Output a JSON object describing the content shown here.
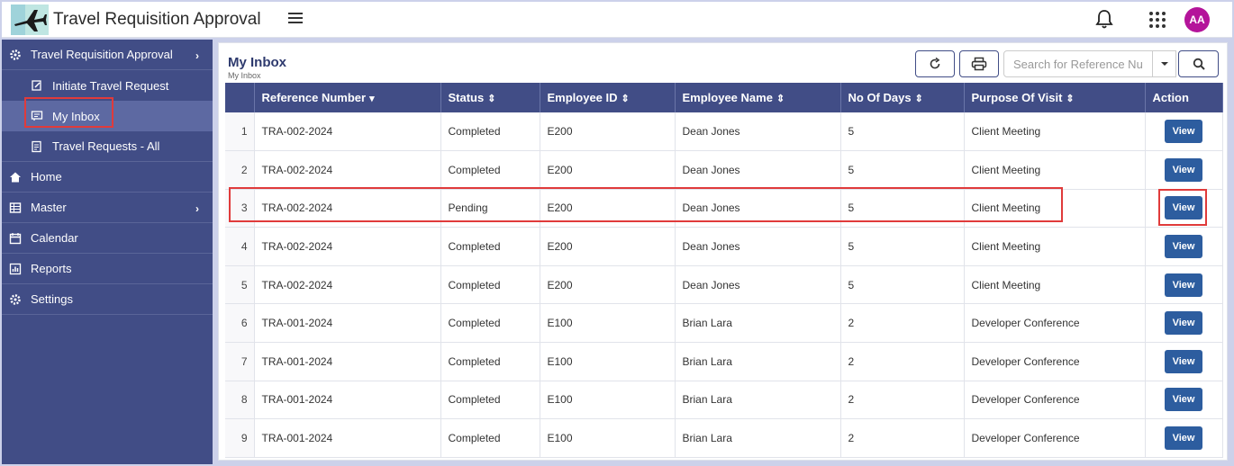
{
  "header": {
    "app_title": "Travel Requisition Approval",
    "avatar_initials": "AA",
    "logo_icon": "airplane-icon"
  },
  "sidebar": {
    "items": [
      {
        "label": "Travel Requisition Approval",
        "icon": "gear-icon",
        "has_chevron": true
      },
      {
        "label": "Initiate Travel Request",
        "icon": "document-edit-icon",
        "sub": true
      },
      {
        "label": "My Inbox",
        "icon": "inbox-icon",
        "sub": true,
        "active": true
      },
      {
        "label": "Travel Requests - All",
        "icon": "list-icon",
        "sub": true
      },
      {
        "label": "Home",
        "icon": "home-icon"
      },
      {
        "label": "Master",
        "icon": "table-icon",
        "has_chevron": true
      },
      {
        "label": "Calendar",
        "icon": "calendar-icon"
      },
      {
        "label": "Reports",
        "icon": "chart-icon"
      },
      {
        "label": "Settings",
        "icon": "gear-icon"
      }
    ]
  },
  "panel": {
    "title": "My Inbox",
    "subtitle": "My Inbox",
    "search_placeholder": "Search for Reference Nu"
  },
  "table": {
    "columns": [
      "Reference Number",
      "Status",
      "Employee ID",
      "Employee Name",
      "No Of Days",
      "Purpose Of Visit",
      "Action"
    ],
    "rows": [
      {
        "n": "1",
        "ref": "TRA-002-2024",
        "status": "Completed",
        "emp_id": "E200",
        "name": "Dean Jones",
        "days": "5",
        "purpose": "Client Meeting",
        "action": "View"
      },
      {
        "n": "2",
        "ref": "TRA-002-2024",
        "status": "Completed",
        "emp_id": "E200",
        "name": "Dean Jones",
        "days": "5",
        "purpose": "Client Meeting",
        "action": "View"
      },
      {
        "n": "3",
        "ref": "TRA-002-2024",
        "status": "Pending",
        "emp_id": "E200",
        "name": "Dean Jones",
        "days": "5",
        "purpose": "Client Meeting",
        "action": "View"
      },
      {
        "n": "4",
        "ref": "TRA-002-2024",
        "status": "Completed",
        "emp_id": "E200",
        "name": "Dean Jones",
        "days": "5",
        "purpose": "Client Meeting",
        "action": "View"
      },
      {
        "n": "5",
        "ref": "TRA-002-2024",
        "status": "Completed",
        "emp_id": "E200",
        "name": "Dean Jones",
        "days": "5",
        "purpose": "Client Meeting",
        "action": "View"
      },
      {
        "n": "6",
        "ref": "TRA-001-2024",
        "status": "Completed",
        "emp_id": "E100",
        "name": "Brian Lara",
        "days": "2",
        "purpose": "Developer Conference",
        "action": "View"
      },
      {
        "n": "7",
        "ref": "TRA-001-2024",
        "status": "Completed",
        "emp_id": "E100",
        "name": "Brian Lara",
        "days": "2",
        "purpose": "Developer Conference",
        "action": "View"
      },
      {
        "n": "8",
        "ref": "TRA-001-2024",
        "status": "Completed",
        "emp_id": "E100",
        "name": "Brian Lara",
        "days": "2",
        "purpose": "Developer Conference",
        "action": "View"
      },
      {
        "n": "9",
        "ref": "TRA-001-2024",
        "status": "Completed",
        "emp_id": "E100",
        "name": "Brian Lara",
        "days": "2",
        "purpose": "Developer Conference",
        "action": "View"
      }
    ]
  },
  "colors": {
    "sidebar_bg": "#414d86",
    "table_header_bg": "#414d86",
    "view_button": "#2d5d9f",
    "avatar": "#b4149a",
    "highlight": "#e03b3b"
  }
}
